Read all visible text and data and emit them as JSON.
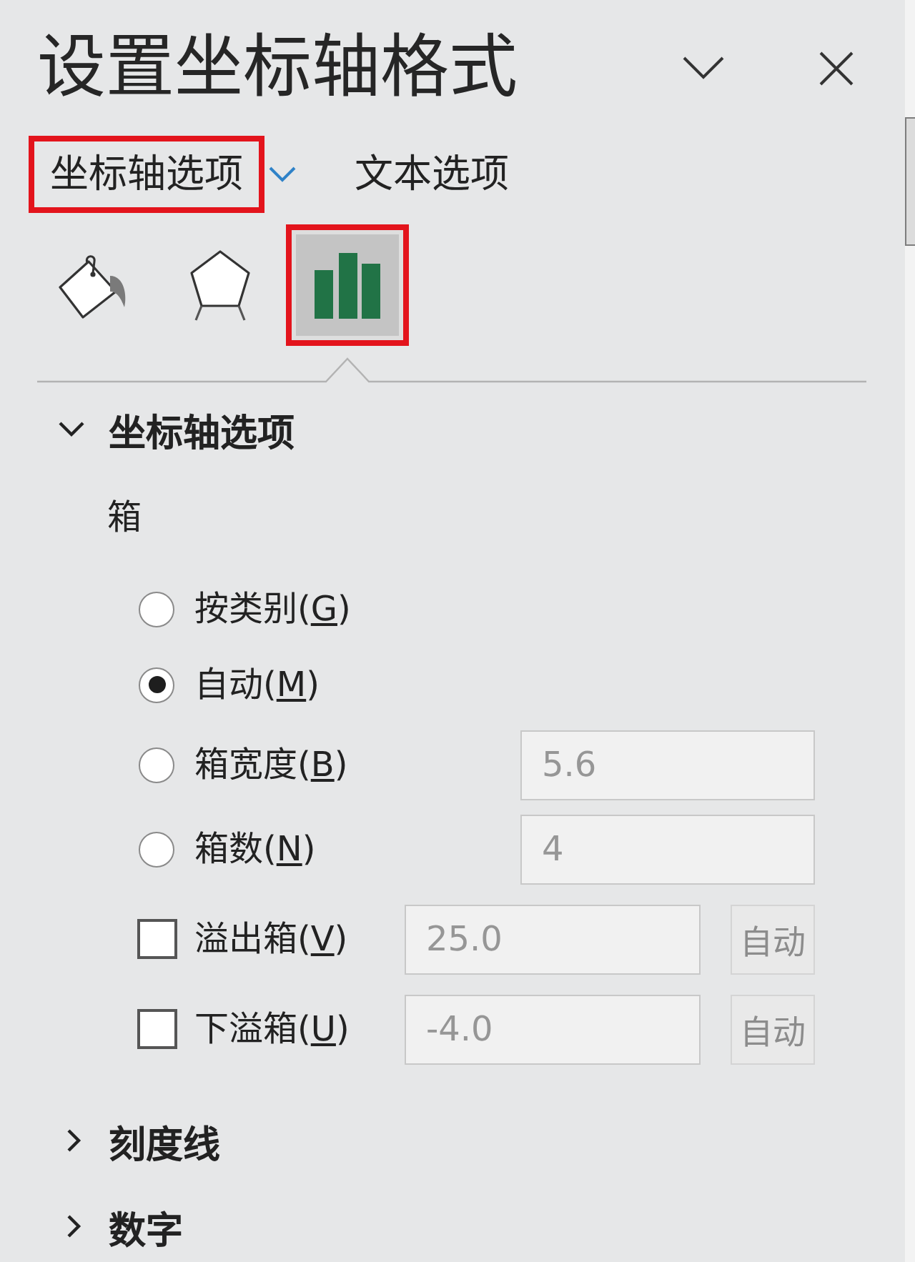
{
  "window": {
    "title": "设置坐标轴格式"
  },
  "tabs": [
    {
      "label": "坐标轴选项",
      "selected": true,
      "highlighted": true
    },
    {
      "label": "文本选项",
      "selected": false,
      "highlighted": false
    }
  ],
  "icon_tabs": [
    {
      "kind": "bucket",
      "selected": false,
      "highlighted": false
    },
    {
      "kind": "pentagon",
      "selected": false,
      "highlighted": false
    },
    {
      "kind": "bars",
      "selected": true,
      "highlighted": true
    }
  ],
  "sections": [
    {
      "title": "坐标轴选项",
      "expanded": true,
      "group_label": "箱",
      "options": [
        {
          "kind": "radio",
          "label": "按类别(",
          "access_key": "G",
          "label_end": ")",
          "selected": false
        },
        {
          "kind": "radio",
          "label": "自动(",
          "access_key": "M",
          "label_end": ")",
          "selected": true
        },
        {
          "kind": "radio",
          "label": "箱宽度(",
          "access_key": "B",
          "label_end": ")",
          "selected": false,
          "field": {
            "value": "5.6",
            "disabled": true
          }
        },
        {
          "kind": "radio",
          "label": "箱数(",
          "access_key": "N",
          "label_end": ")",
          "selected": false,
          "field": {
            "value": "4",
            "disabled": true
          }
        },
        {
          "kind": "checkbox",
          "label": "溢出箱(",
          "access_key": "V",
          "label_end": ")",
          "checked": false,
          "field": {
            "value": "25.0",
            "disabled": true
          },
          "button": {
            "label": "自动",
            "disabled": true
          }
        },
        {
          "kind": "checkbox",
          "label": "下溢箱(",
          "access_key": "U",
          "label_end": ")",
          "checked": false,
          "field": {
            "value": "-4.0",
            "disabled": true
          },
          "button": {
            "label": "自动",
            "disabled": true
          }
        }
      ]
    },
    {
      "title": "刻度线",
      "expanded": false
    },
    {
      "title": "数字",
      "expanded": false
    }
  ]
}
